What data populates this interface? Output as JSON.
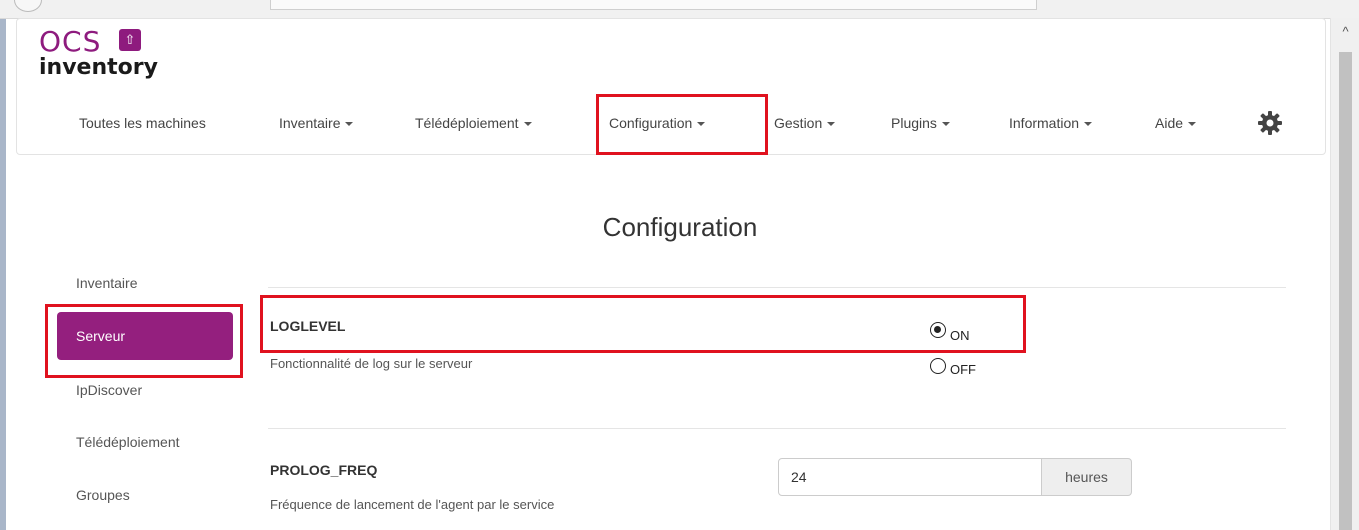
{
  "logo": {
    "ocs": "OCS",
    "inventory": "inventory"
  },
  "nav": {
    "items": [
      {
        "label": "Toutes les machines",
        "caret": false
      },
      {
        "label": "Inventaire",
        "caret": true
      },
      {
        "label": "Télédéploiement",
        "caret": true
      },
      {
        "label": "Configuration",
        "caret": true
      },
      {
        "label": "Gestion",
        "caret": true
      },
      {
        "label": "Plugins",
        "caret": true
      },
      {
        "label": "Information",
        "caret": true
      },
      {
        "label": "Aide",
        "caret": true
      }
    ],
    "settings_icon": "gear-icon"
  },
  "page": {
    "title": "Configuration"
  },
  "sidebar": {
    "items": [
      {
        "label": "Inventaire",
        "active": false
      },
      {
        "label": "Serveur",
        "active": true
      },
      {
        "label": "IpDiscover",
        "active": false
      },
      {
        "label": "Télédéploiement",
        "active": false
      },
      {
        "label": "Groupes",
        "active": false
      }
    ]
  },
  "settings": {
    "loglevel": {
      "name": "LOGLEVEL",
      "description": "Fonctionnalité de log sur le serveur",
      "options": [
        {
          "label": "ON",
          "selected": true
        },
        {
          "label": "OFF",
          "selected": false
        }
      ]
    },
    "prolog_freq": {
      "name": "PROLOG_FREQ",
      "description": "Fréquence de lancement de l'agent par le service",
      "value": "24",
      "unit": "heures"
    }
  },
  "colors": {
    "accent": "#941f7e",
    "highlight": "#e0121f",
    "brand": "#8e1b7e"
  }
}
